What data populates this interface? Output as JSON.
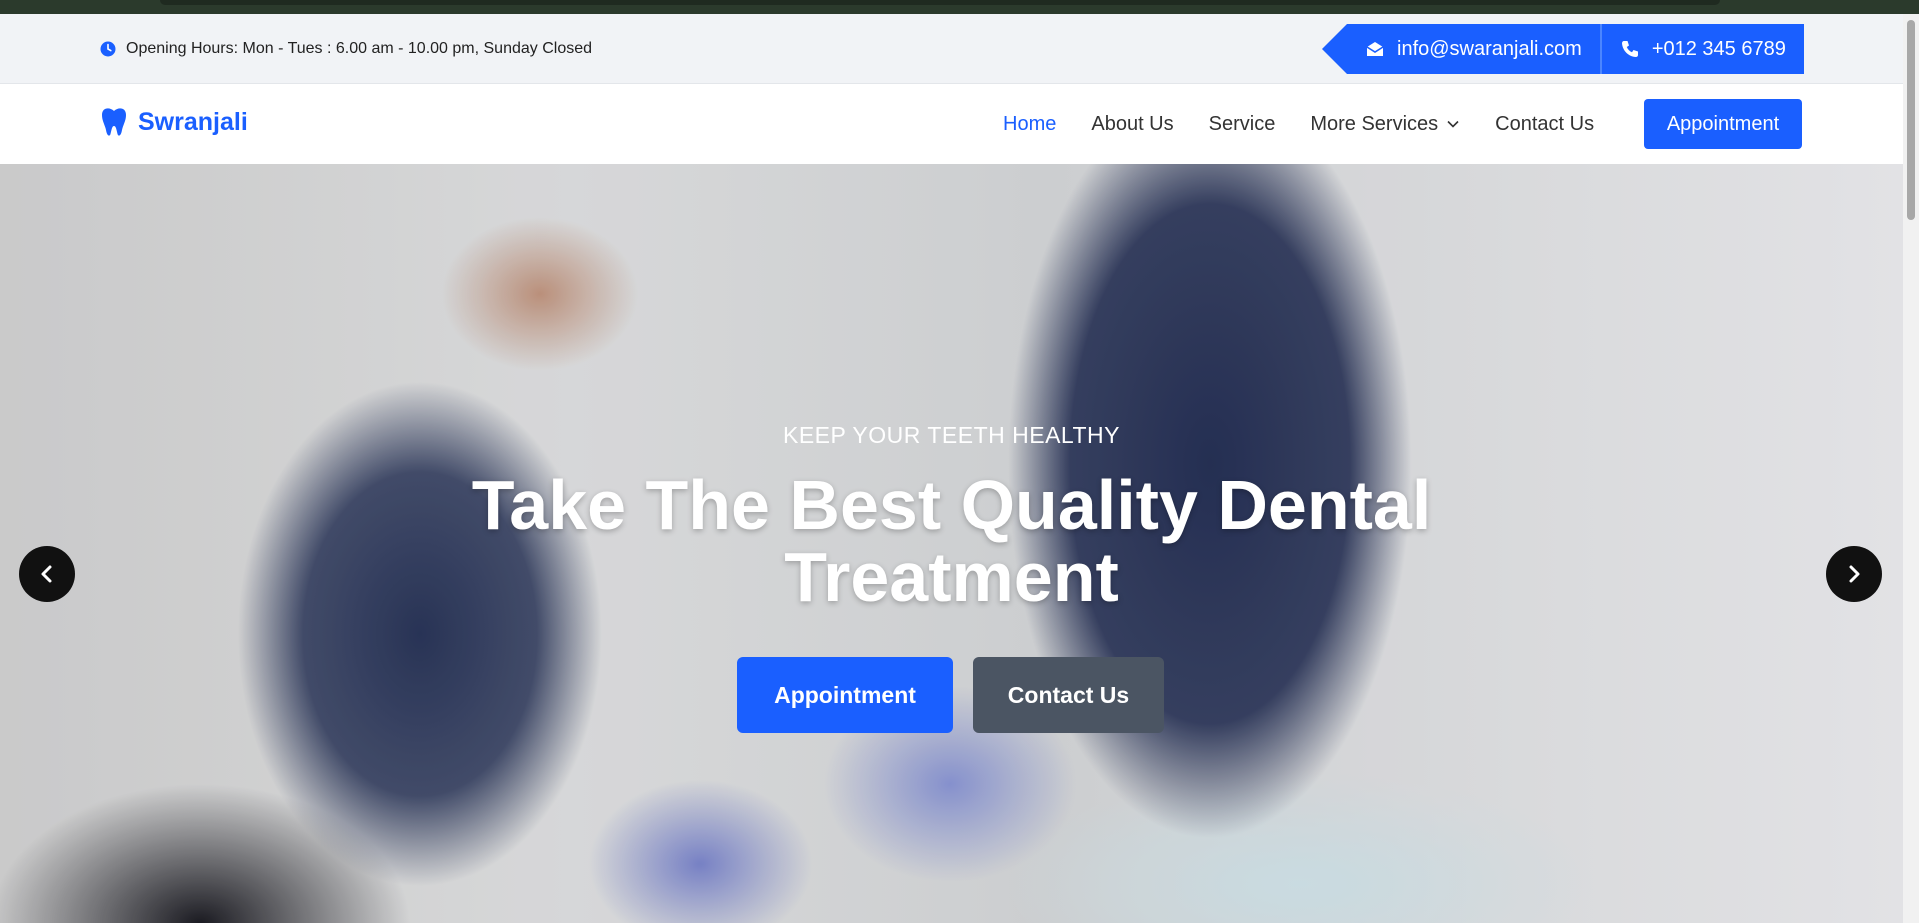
{
  "topbar": {
    "opening_hours": "Opening Hours: Mon - Tues : 6.00 am - 10.00 pm, Sunday Closed",
    "email": "info@swaranjali.com",
    "phone": "+012 345 6789"
  },
  "navbar": {
    "brand": "Swranjali",
    "links": [
      {
        "label": "Home",
        "active": true
      },
      {
        "label": "About Us"
      },
      {
        "label": "Service"
      },
      {
        "label": "More Services",
        "has_dropdown": true
      },
      {
        "label": "Contact Us"
      }
    ],
    "cta": "Appointment"
  },
  "hero": {
    "subtitle": "KEEP YOUR TEETH HEALTHY",
    "title": "Take The Best Quality Dental Treatment",
    "primary_button": "Appointment",
    "secondary_button": "Contact Us"
  },
  "colors": {
    "accent": "#1a5fff",
    "secondary": "#4b5563"
  },
  "icons": [
    "clock-icon",
    "envelope-icon",
    "phone-icon",
    "tooth-icon",
    "chevron-down-icon",
    "chevron-left-icon",
    "chevron-right-icon"
  ]
}
